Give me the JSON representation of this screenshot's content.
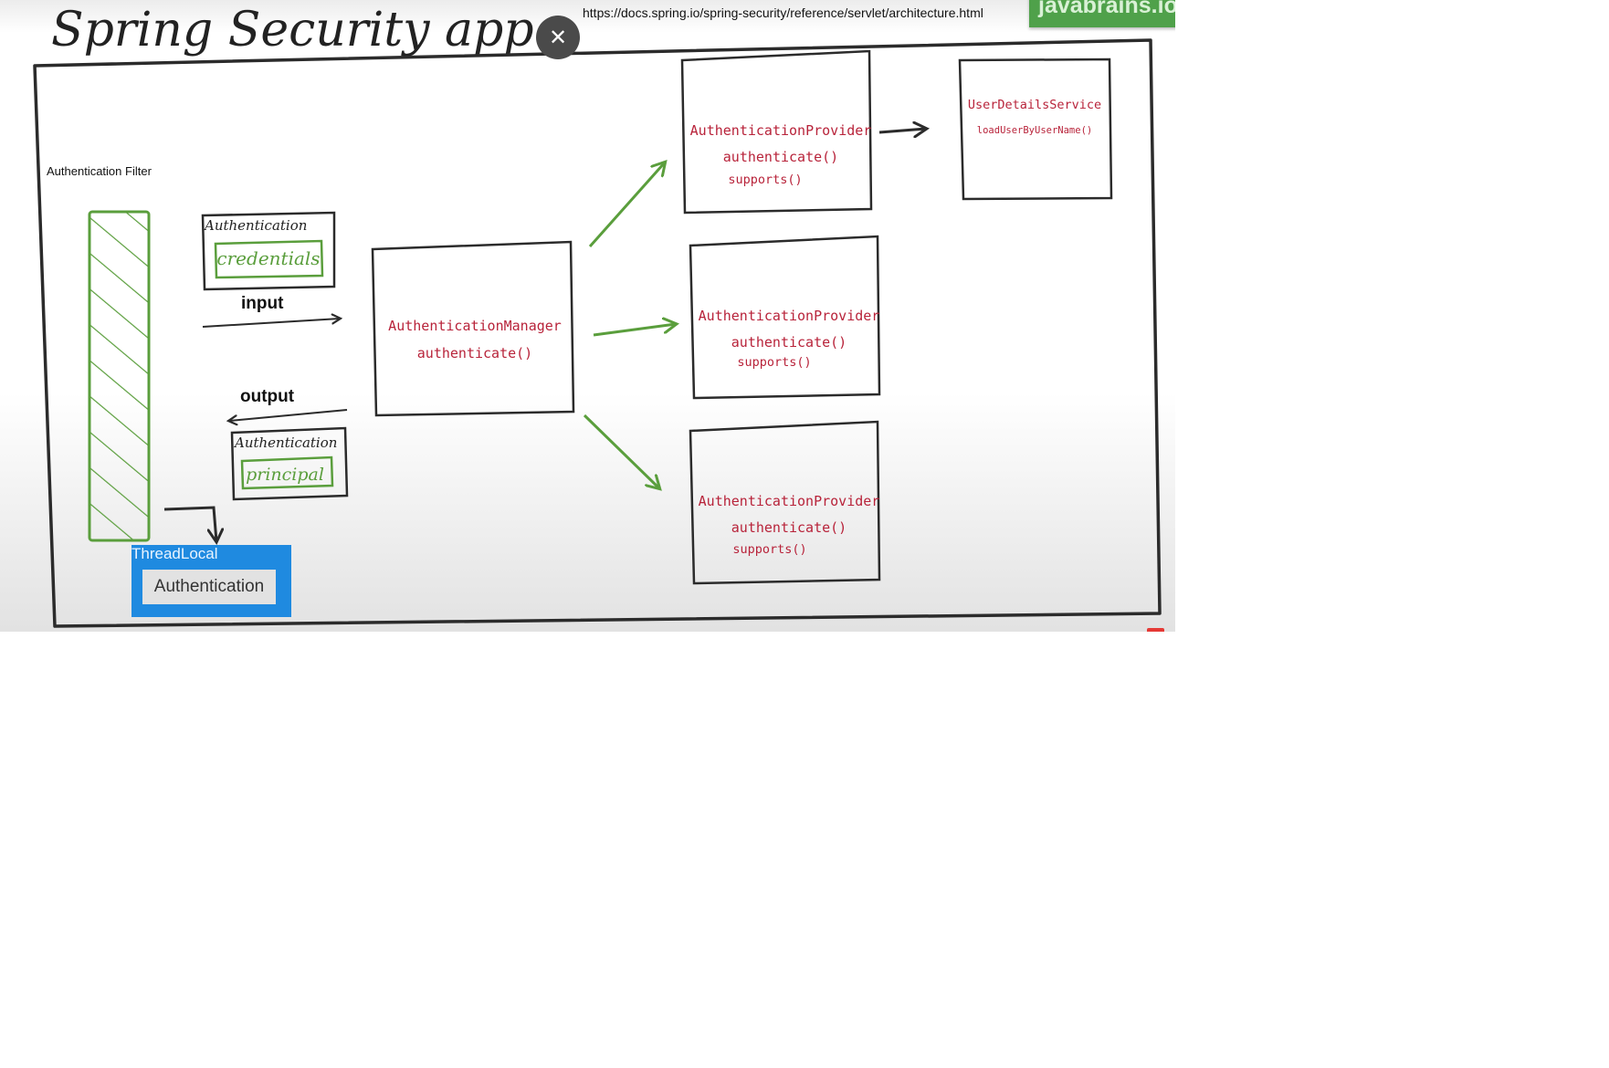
{
  "overlay": {
    "url": "https://docs.spring.io/spring-security/reference/servlet/architecture.html",
    "brand": "javabrains.io",
    "close_symbol": "✕",
    "close_icon": "close-icon"
  },
  "diagram": {
    "title": "Spring Security app",
    "filter_label": "Authentication Filter",
    "input": {
      "label": "input",
      "box_title": "Authentication",
      "box_inner": "credentials"
    },
    "output": {
      "label": "output",
      "box_title": "Authentication",
      "box_inner": "principal"
    },
    "manager": {
      "name": "AuthenticationManager",
      "method": "authenticate()"
    },
    "providers": [
      {
        "name": "AuthenticationProvider",
        "method1": "authenticate()",
        "method2": "supports()"
      },
      {
        "name": "AuthenticationProvider",
        "method1": "authenticate()",
        "method2": "supports()"
      },
      {
        "name": "AuthenticationProvider",
        "method1": "authenticate()",
        "method2": "supports()"
      }
    ],
    "user_details": {
      "name": "UserDetailsService",
      "method": "loadUserByUserName()"
    },
    "threadlocal": {
      "title": "ThreadLocal",
      "inner": "Authentication"
    },
    "colors": {
      "ink": "#2b2b2b",
      "green": "#5a9e3c",
      "code_red": "#b8233a",
      "threadlocal_blue": "#1f8ae0"
    }
  }
}
